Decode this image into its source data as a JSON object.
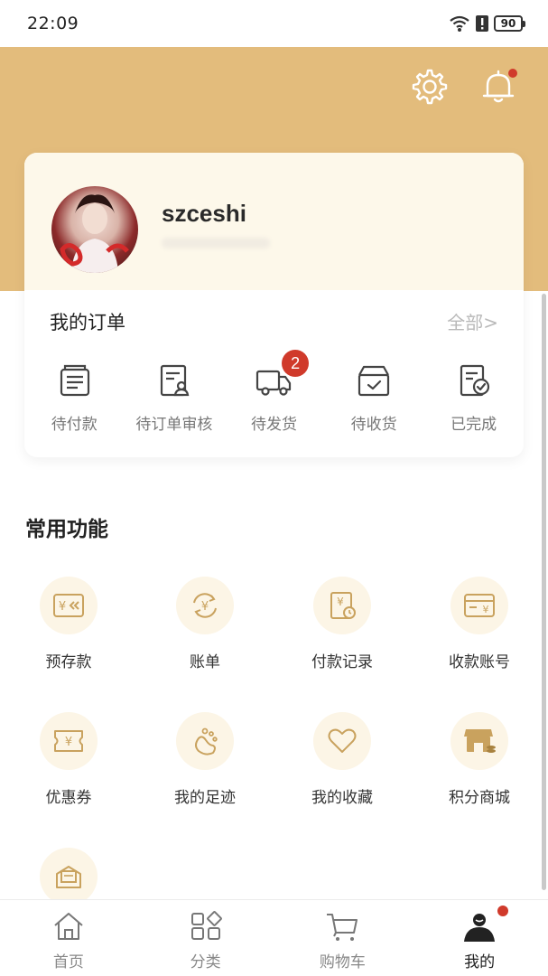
{
  "status_bar": {
    "time": "22:09",
    "battery": "90"
  },
  "profile": {
    "username": "szceshi"
  },
  "orders": {
    "title": "我的订单",
    "all_link": "全部>",
    "items": [
      {
        "label": "待付款",
        "icon": "wallet-list-icon"
      },
      {
        "label": "待订单审核",
        "icon": "document-review-icon"
      },
      {
        "label": "待发货",
        "icon": "truck-icon",
        "badge": "2"
      },
      {
        "label": "待收货",
        "icon": "box-check-icon"
      },
      {
        "label": "已完成",
        "icon": "document-check-icon"
      }
    ]
  },
  "common": {
    "title": "常用功能",
    "items": [
      {
        "label": "预存款",
        "icon": "prepaid-icon"
      },
      {
        "label": "账单",
        "icon": "bill-icon"
      },
      {
        "label": "付款记录",
        "icon": "payment-record-icon"
      },
      {
        "label": "收款账号",
        "icon": "receiving-account-icon"
      },
      {
        "label": "优惠券",
        "icon": "coupon-icon"
      },
      {
        "label": "我的足迹",
        "icon": "footprint-icon"
      },
      {
        "label": "我的收藏",
        "icon": "heart-icon"
      },
      {
        "label": "积分商城",
        "icon": "points-store-icon"
      },
      {
        "label": "",
        "icon": "mail-icon"
      }
    ]
  },
  "bottom_nav": {
    "items": [
      {
        "label": "首页",
        "icon": "home-icon"
      },
      {
        "label": "分类",
        "icon": "category-icon"
      },
      {
        "label": "购物车",
        "icon": "cart-icon"
      },
      {
        "label": "我的",
        "icon": "profile-icon",
        "active": true
      }
    ]
  },
  "colors": {
    "header": "#e3bc7c",
    "accent": "#c9a25e",
    "badge": "#d03a2b",
    "icon_bg": "#fcf5e6"
  }
}
